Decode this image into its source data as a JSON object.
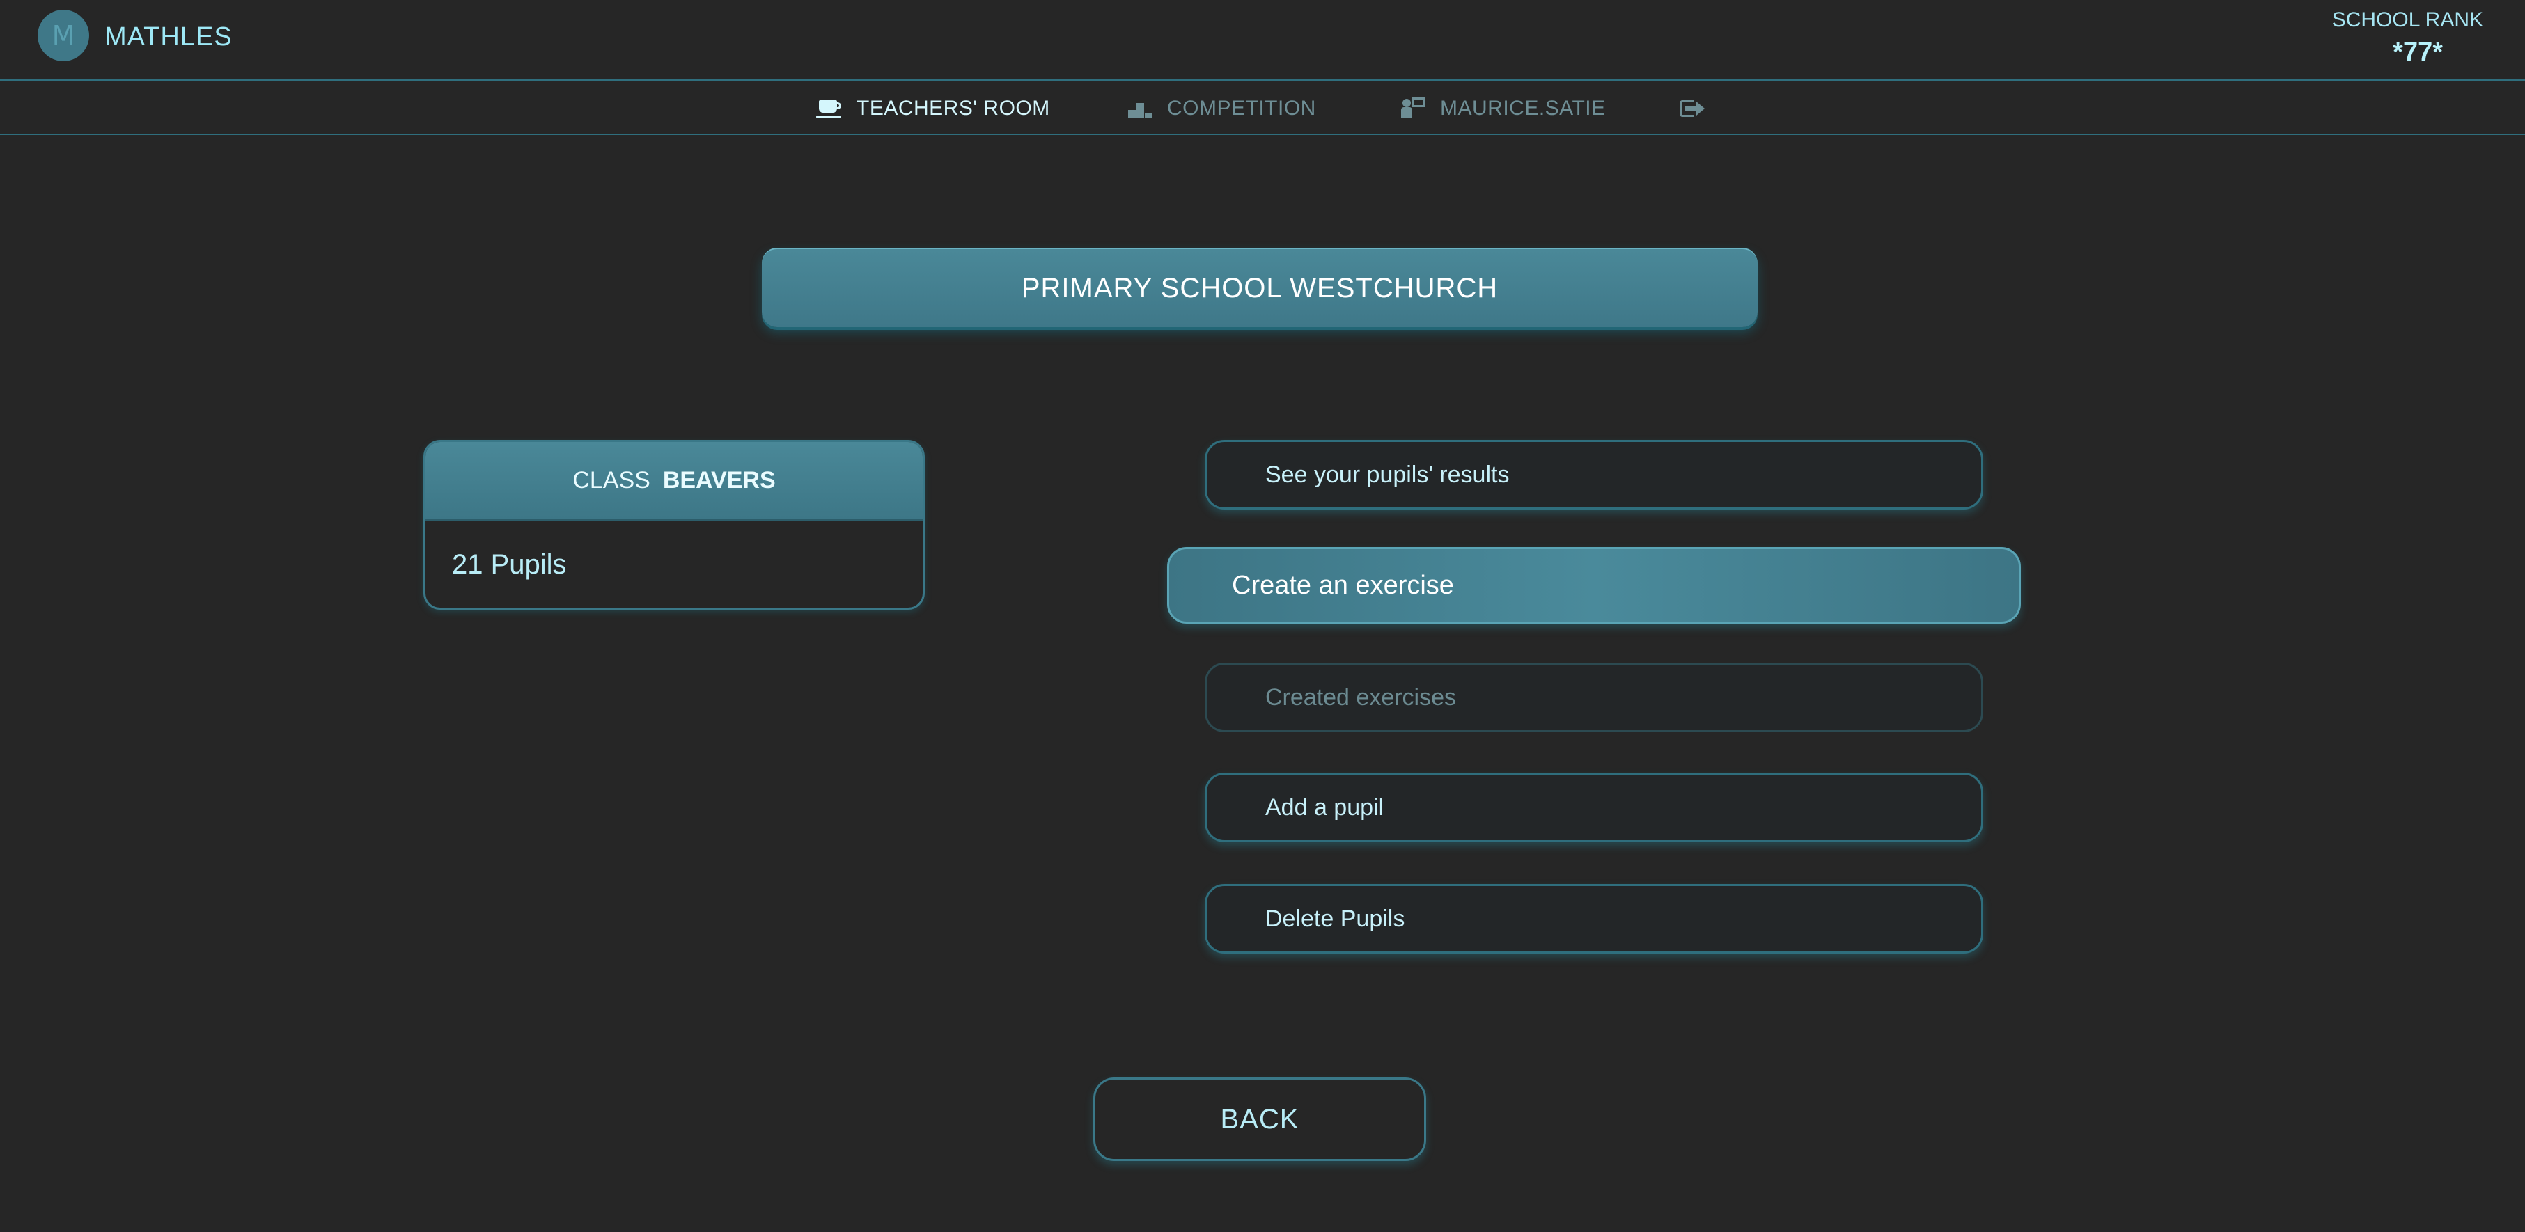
{
  "header": {
    "app_title": "MATHLES",
    "logo_letter": "M",
    "rank_label": "SCHOOL RANK",
    "rank_value": "*77*"
  },
  "nav": {
    "items": [
      {
        "label": "TEACHERS' ROOM",
        "icon": "coffee-cup-icon",
        "active": true
      },
      {
        "label": "COMPETITION",
        "icon": "podium-icon",
        "active": false
      },
      {
        "label": "MAURICE.SATIE",
        "icon": "teacher-icon",
        "active": false
      },
      {
        "label": "",
        "icon": "logout-icon",
        "active": false
      }
    ]
  },
  "school": {
    "name": "PRIMARY SCHOOL WESTCHURCH"
  },
  "class_card": {
    "label": "CLASS",
    "name": "BEAVERS",
    "pupils": "21 Pupils"
  },
  "menu": {
    "items": [
      {
        "label": "See your pupils' results",
        "state": "normal"
      },
      {
        "label": "Create an exercise",
        "state": "active"
      },
      {
        "label": "Created exercises",
        "state": "disabled"
      },
      {
        "label": "Add a pupil",
        "state": "normal"
      },
      {
        "label": "Delete Pupils",
        "state": "normal"
      }
    ]
  },
  "back_label": "BACK",
  "colors": {
    "background": "#262626",
    "accent": "#4a8898",
    "text": "#bfe9f2"
  }
}
